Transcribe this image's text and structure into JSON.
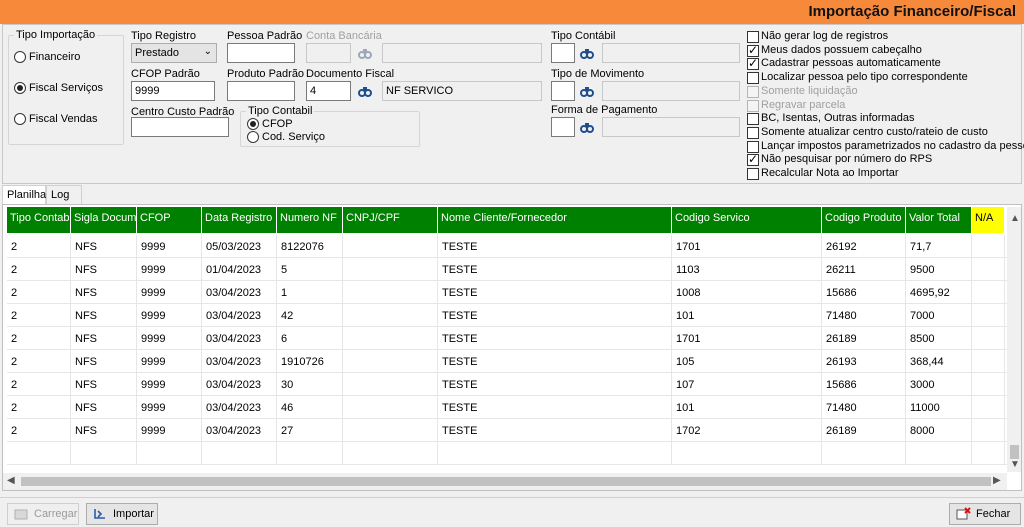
{
  "title": "Importação Financeiro/Fiscal",
  "tipo_importacao": {
    "label": "Tipo Importação",
    "options": [
      "Financeiro",
      "Fiscal Serviços",
      "Fiscal Vendas"
    ],
    "selected": "Fiscal Serviços"
  },
  "fields": {
    "tipo_registro_label": "Tipo Registro",
    "tipo_registro_value": "Prestado",
    "pessoa_padrao_label": "Pessoa Padrão",
    "pessoa_padrao_value": "",
    "conta_bancaria_label": "Conta Bancária",
    "cfop_padrao_label": "CFOP Padrão",
    "cfop_padrao_value": "9999",
    "produto_padrao_label": "Produto Padrão",
    "produto_padrao_value": "",
    "documento_fiscal_label": "Documento Fiscal",
    "documento_fiscal_code": "4",
    "documento_fiscal_desc": "NF SERVICO",
    "centro_custo_label": "Centro Custo Padrão",
    "centro_custo_value": "",
    "tipo_contabil_group_label": "Tipo Contabil",
    "tipo_contabil_options": [
      "CFOP",
      "Cod. Serviço"
    ],
    "tipo_contabil_selected": "CFOP",
    "tipo_contabil_label": "Tipo Contábil",
    "tipo_movimento_label": "Tipo de Movimento",
    "forma_pagamento_label": "Forma de Pagamento"
  },
  "options": [
    {
      "label": "Não gerar log de registros",
      "checked": false,
      "enabled": true
    },
    {
      "label": "Meus dados possuem cabeçalho",
      "checked": true,
      "enabled": true
    },
    {
      "label": "Cadastrar pessoas automaticamente",
      "checked": true,
      "enabled": true
    },
    {
      "label": "Localizar pessoa pelo tipo correspondente",
      "checked": false,
      "enabled": true
    },
    {
      "label": "Somente liquidação",
      "checked": false,
      "enabled": false
    },
    {
      "label": "Regravar parcela",
      "checked": false,
      "enabled": false
    },
    {
      "label": "BC, Isentas, Outras informadas",
      "checked": false,
      "enabled": true
    },
    {
      "label": "Somente atualizar centro custo/rateio de custo",
      "checked": false,
      "enabled": true
    },
    {
      "label": "Lançar impostos parametrizados no cadastro da pessoa",
      "checked": false,
      "enabled": true
    },
    {
      "label": "Não pesquisar por número do RPS",
      "checked": true,
      "enabled": true
    },
    {
      "label": "Recalcular Nota ao Importar",
      "checked": false,
      "enabled": true
    }
  ],
  "tabs": [
    "Planilha",
    "Log"
  ],
  "active_tab": "Planilha",
  "grid": {
    "columns": [
      "Tipo Contabil",
      "Sigla Documento",
      "CFOP",
      "Data Registro",
      "Numero NF",
      "CNPJ/CPF",
      "Nome Cliente/Fornecedor",
      "Codigo Servico",
      "Codigo Produto",
      "Valor Total",
      "N/A"
    ],
    "rows": [
      [
        "2",
        "NFS",
        "9999",
        "05/03/2023",
        "8122076",
        "",
        "TESTE",
        "1701",
        "26192",
        "71,7",
        ""
      ],
      [
        "2",
        "NFS",
        "9999",
        "01/04/2023",
        "5",
        "",
        "TESTE",
        "1103",
        "26211",
        "9500",
        ""
      ],
      [
        "2",
        "NFS",
        "9999",
        "03/04/2023",
        "1",
        "",
        "TESTE",
        "1008",
        "15686",
        "4695,92",
        ""
      ],
      [
        "2",
        "NFS",
        "9999",
        "03/04/2023",
        "42",
        "",
        "TESTE",
        "101",
        "71480",
        "7000",
        ""
      ],
      [
        "2",
        "NFS",
        "9999",
        "03/04/2023",
        "6",
        "",
        "TESTE",
        "1701",
        "26189",
        "8500",
        ""
      ],
      [
        "2",
        "NFS",
        "9999",
        "03/04/2023",
        "1910726",
        "",
        "TESTE",
        "105",
        "26193",
        "368,44",
        ""
      ],
      [
        "2",
        "NFS",
        "9999",
        "03/04/2023",
        "30",
        "",
        "TESTE",
        "107",
        "15686",
        "3000",
        ""
      ],
      [
        "2",
        "NFS",
        "9999",
        "03/04/2023",
        "46",
        "",
        "TESTE",
        "101",
        "71480",
        "11000",
        ""
      ],
      [
        "2",
        "NFS",
        "9999",
        "03/04/2023",
        "27",
        "",
        "TESTE",
        "1702",
        "26189",
        "8000",
        ""
      ]
    ]
  },
  "buttons": {
    "carregar": "Carregar",
    "importar": "Importar",
    "fechar": "Fechar"
  },
  "colors": {
    "titlebar": "#f7893a",
    "header_green": "#008000",
    "header_na": "#ffff00"
  }
}
